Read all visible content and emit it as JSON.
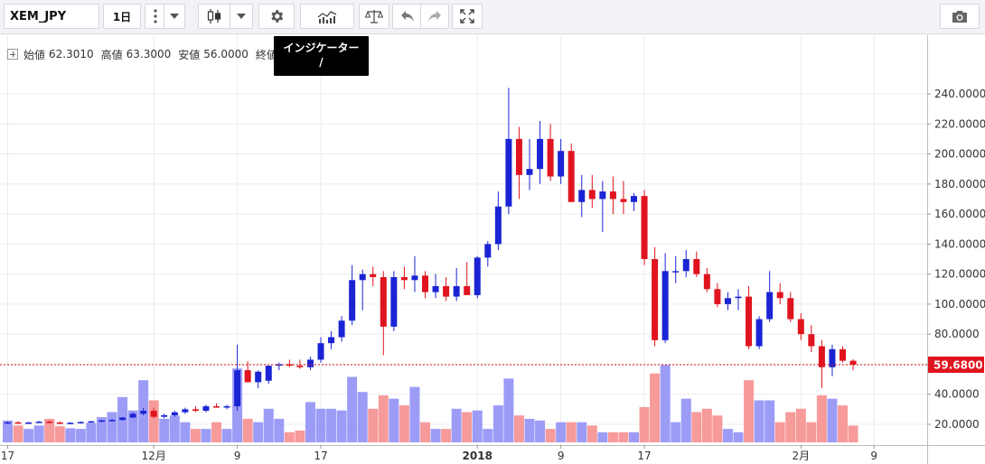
{
  "toolbar": {
    "symbol": "XEM_JPY",
    "interval": "1日",
    "icons": [
      "more-vertical-icon",
      "chevron-down-icon",
      "candlestick-icon",
      "chevron-down-icon",
      "gear-icon",
      "indicators-icon",
      "scale-icon",
      "undo-icon",
      "redo-icon",
      "fullscreen-icon",
      "camera-icon"
    ]
  },
  "tooltip": {
    "line1": "インジケーター",
    "line2": "/"
  },
  "legend": {
    "open_label": "始値",
    "open": "62.3010",
    "high_label": "高値",
    "high": "63.3000",
    "low_label": "安値",
    "low": "56.0000",
    "close_label": "終値"
  },
  "colors": {
    "up": "#1a24d4",
    "down": "#e0141e",
    "vol_up": "#9c9cf7",
    "vol_down": "#f79a9a",
    "price_line": "#e0141e",
    "price_label_bg": "#e0141e",
    "grid": "#ececec"
  },
  "chart_data": {
    "type": "candlestick",
    "symbol": "XEM_JPY",
    "interval": "1日",
    "ylim": [
      5,
      250
    ],
    "y_ticks": [
      20,
      40,
      60,
      80,
      100,
      120,
      140,
      160,
      180,
      200,
      220,
      240
    ],
    "y_tick_labels": [
      "20.0000",
      "40.0000",
      "60.0000",
      "80.0000",
      "100.0000",
      "120.0000",
      "140.0000",
      "160.0000",
      "180.0000",
      "200.0000",
      "220.0000",
      "240.0000"
    ],
    "last_price": 59.68,
    "last_price_label": "59.6800",
    "x_ticks": [
      {
        "label": "17",
        "i": 0
      },
      {
        "label": "12月",
        "i": 14
      },
      {
        "label": "9",
        "i": 22
      },
      {
        "label": "17",
        "i": 30
      },
      {
        "label": "2018",
        "i": 45,
        "bold": true
      },
      {
        "label": "9",
        "i": 53
      },
      {
        "label": "17",
        "i": 61
      },
      {
        "label": "2月",
        "i": 76
      },
      {
        "label": "9",
        "i": 83
      }
    ],
    "ohlc": [
      [
        21.0,
        21.8,
        20.4,
        21.3
      ],
      [
        21.3,
        22.0,
        20.5,
        20.9
      ],
      [
        20.9,
        21.6,
        20.3,
        21.2
      ],
      [
        21.2,
        22.2,
        20.8,
        21.7
      ],
      [
        21.7,
        22.4,
        20.9,
        21.2
      ],
      [
        21.2,
        21.9,
        20.2,
        20.7
      ],
      [
        20.7,
        21.4,
        20.1,
        21.0
      ],
      [
        21.0,
        21.9,
        20.5,
        21.5
      ],
      [
        21.5,
        22.3,
        21.0,
        22.0
      ],
      [
        22.0,
        23.0,
        21.4,
        22.6
      ],
      [
        22.6,
        23.4,
        21.8,
        22.9
      ],
      [
        22.9,
        24.8,
        22.5,
        24.5
      ],
      [
        24.5,
        28.0,
        24.0,
        27.0
      ],
      [
        27.0,
        31.0,
        26.0,
        29.0
      ],
      [
        29.0,
        31.0,
        24.0,
        25.0
      ],
      [
        25.0,
        27.0,
        24.0,
        26.0
      ],
      [
        26.0,
        29.0,
        25.0,
        28.0
      ],
      [
        28.0,
        31.0,
        27.0,
        30.0
      ],
      [
        30.0,
        32.0,
        28.0,
        29.0
      ],
      [
        29.0,
        33.0,
        28.0,
        32.0
      ],
      [
        32.0,
        34.0,
        31.0,
        31.5
      ],
      [
        31.5,
        33.0,
        30.0,
        32.0
      ],
      [
        32.0,
        73.0,
        29.0,
        56.0
      ],
      [
        56.0,
        62.0,
        51.0,
        48.0
      ],
      [
        48.0,
        56.0,
        44.0,
        55.0
      ],
      [
        49.0,
        58.0,
        47.0,
        59.0
      ],
      [
        59.0,
        61.0,
        56.0,
        60.0
      ],
      [
        60.0,
        63.0,
        58.0,
        59.0
      ],
      [
        59.0,
        63.0,
        57.0,
        58.0
      ],
      [
        58.0,
        65.0,
        56.0,
        63.0
      ],
      [
        63.0,
        78.0,
        61.0,
        74.0
      ],
      [
        74.0,
        82.0,
        70.0,
        78.0
      ],
      [
        78.0,
        92.0,
        75.0,
        89.0
      ],
      [
        89.0,
        126.0,
        86.0,
        116.0
      ],
      [
        116.0,
        123.0,
        96.0,
        120.0
      ],
      [
        120.0,
        125.0,
        112.0,
        118.0
      ],
      [
        118.0,
        122.0,
        66.0,
        85.0
      ],
      [
        85.0,
        122.0,
        82.0,
        118.0
      ],
      [
        118.0,
        125.0,
        110.0,
        116.0
      ],
      [
        116.0,
        132.0,
        108.0,
        119.0
      ],
      [
        119.0,
        122.0,
        104.0,
        108.0
      ],
      [
        108.0,
        120.0,
        104.0,
        112.0
      ],
      [
        112.0,
        118.0,
        102.0,
        105.0
      ],
      [
        105.0,
        124.0,
        102.0,
        112.0
      ],
      [
        112.0,
        128.0,
        106.0,
        106.0
      ],
      [
        106.0,
        132.0,
        104.0,
        131.0
      ],
      [
        131.0,
        142.0,
        125.0,
        140.0
      ],
      [
        140.0,
        175.0,
        136.0,
        165.0
      ],
      [
        165.0,
        244.0,
        160.0,
        210.0
      ],
      [
        210.0,
        218.0,
        170.0,
        186.0
      ],
      [
        186.0,
        210.0,
        176.0,
        190.0
      ],
      [
        190.0,
        222.0,
        180.0,
        210.0
      ],
      [
        210.0,
        220.0,
        182.0,
        185.0
      ],
      [
        185.0,
        210.0,
        180.0,
        202.0
      ],
      [
        202.0,
        207.0,
        169.0,
        168.0
      ],
      [
        168.0,
        186.0,
        158.0,
        176.0
      ],
      [
        176.0,
        186.0,
        164.0,
        170.0
      ],
      [
        170.0,
        182.0,
        148.0,
        175.0
      ],
      [
        175.0,
        185.0,
        160.0,
        170.0
      ],
      [
        170.0,
        182.0,
        160.0,
        168.0
      ],
      [
        168.0,
        174.0,
        162.0,
        172.0
      ],
      [
        172.0,
        176.0,
        126.0,
        130.0
      ],
      [
        130.0,
        138.0,
        72.0,
        76.0
      ],
      [
        76.0,
        134.0,
        74.0,
        122.0
      ],
      [
        122.0,
        132.0,
        114.0,
        122.0
      ],
      [
        122.0,
        136.0,
        118.0,
        130.0
      ],
      [
        130.0,
        135.0,
        118.0,
        120.0
      ],
      [
        120.0,
        124.0,
        108.0,
        110.0
      ],
      [
        110.0,
        114.0,
        98.0,
        100.0
      ],
      [
        100.0,
        108.0,
        96.0,
        104.0
      ],
      [
        104.0,
        110.0,
        96.0,
        105.0
      ],
      [
        105.0,
        112.0,
        70.0,
        72.0
      ],
      [
        72.0,
        92.0,
        70.0,
        90.0
      ],
      [
        90.0,
        122.0,
        88.0,
        108.0
      ],
      [
        108.0,
        114.0,
        100.0,
        104.0
      ],
      [
        104.0,
        108.0,
        88.0,
        90.0
      ],
      [
        90.0,
        94.0,
        76.0,
        80.0
      ],
      [
        80.0,
        86.0,
        68.0,
        72.0
      ],
      [
        72.0,
        76.0,
        44.0,
        58.0
      ],
      [
        58.0,
        73.0,
        52.0,
        70.0
      ],
      [
        70.0,
        72.0,
        61.0,
        62.3
      ],
      [
        62.3,
        63.3,
        56.0,
        59.68
      ]
    ],
    "volume": [
      6.5,
      5.0,
      4.0,
      5.0,
      7.0,
      4.8,
      4.2,
      4.0,
      5.8,
      7.5,
      9.0,
      13.5,
      9.5,
      18.5,
      12.5,
      7.0,
      8.0,
      6.0,
      4.0,
      4.0,
      6.0,
      4.0,
      22.0,
      7.0,
      6.0,
      10.0,
      7.0,
      3.0,
      3.5,
      12.0,
      10.0,
      10.0,
      9.5,
      19.5,
      15.0,
      10.0,
      14.0,
      13.0,
      11.0,
      16.5,
      6.0,
      4.0,
      4.0,
      10.0,
      9.0,
      9.5,
      4.0,
      11.0,
      19.0,
      8.0,
      7.0,
      6.5,
      4.0,
      6.0,
      6.0,
      6.0,
      5.0,
      3.0,
      3.0,
      3.0,
      3.0,
      10.5,
      20.5,
      23.0,
      6.0,
      13.0,
      9.0,
      10.0,
      8.0,
      4.0,
      3.0,
      18.5,
      12.5,
      12.5,
      6.0,
      9.0,
      10.0,
      6.0,
      14.0,
      13.0,
      11.0,
      5.0
    ]
  }
}
